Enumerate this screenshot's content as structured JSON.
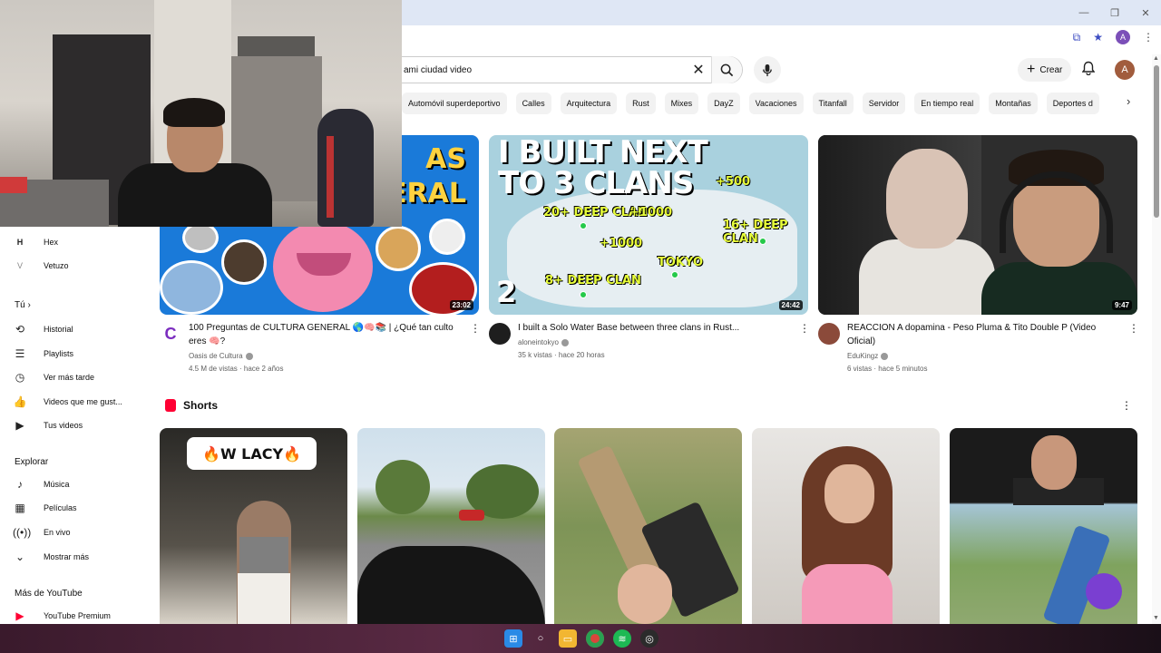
{
  "search": {
    "query": "ami ciudad video"
  },
  "header": {
    "create_label": "Crear",
    "avatar_letter": "A"
  },
  "browser": {
    "profile_letter": "A"
  },
  "chips": [
    "Automóvil superdeportivo",
    "Calles",
    "Arquitectura",
    "Rust",
    "Mixes",
    "DayZ",
    "Vacaciones",
    "Titanfall",
    "Servidor",
    "En tiempo real",
    "Montañas",
    "Deportes d"
  ],
  "sidebar": {
    "subs": [
      {
        "icon": "H",
        "label": "Hex"
      },
      {
        "icon": "V",
        "label": "Vetuzo"
      }
    ],
    "you_heading": "Tú",
    "you_items": [
      {
        "icon": "history-icon",
        "label": "Historial"
      },
      {
        "icon": "playlists-icon",
        "label": "Playlists"
      },
      {
        "icon": "watch-later-icon",
        "label": "Ver más tarde"
      },
      {
        "icon": "liked-icon",
        "label": "Videos que me gust..."
      },
      {
        "icon": "your-videos-icon",
        "label": "Tus videos"
      }
    ],
    "explore_heading": "Explorar",
    "explore_items": [
      {
        "icon": "music-icon",
        "label": "Música"
      },
      {
        "icon": "movies-icon",
        "label": "Películas"
      },
      {
        "icon": "live-icon",
        "label": "En vivo"
      },
      {
        "icon": "chevron-down-icon",
        "label": "Mostrar más"
      }
    ],
    "more_heading": "Más de YouTube",
    "more_items": [
      {
        "icon": "youtube-premium-icon",
        "label": "YouTube Premium"
      }
    ]
  },
  "videos": [
    {
      "thumb_text": "AS\nERAL",
      "duration": "23:02",
      "title": "100 Preguntas de CULTURA GENERAL 🌎🧠📚 | ¿Qué tan culto eres 🧠?",
      "channel": "Oasis de Cultura",
      "meta": "4.5 M de vistas · hace 2 años",
      "avatar_color": "#7b2cbf"
    },
    {
      "thumb_title": "I BUILT NEXT\nTO 3 CLANS",
      "thumb_labels": [
        "20+ DEEP CLAN",
        "+1000",
        "+500",
        "16+ DEEP CLAN",
        "+1000",
        "TOKYO",
        "8+ DEEP CLAN"
      ],
      "thumb_number": "2",
      "duration": "24:42",
      "title": "I built a Solo Water Base between three clans in Rust...",
      "channel": "aloneintokyo",
      "meta": "35 k vistas · hace 20 horas",
      "avatar_color": "#1e1e1e"
    },
    {
      "duration": "9:47",
      "title": "REACCION A dopamina - Peso Pluma & Tito Double P (Video Oficial)",
      "channel": "EduKingz",
      "meta": "6 vistas · hace 5 minutos",
      "avatar_color": "#8b4a3a"
    }
  ],
  "shorts": {
    "heading": "Shorts",
    "items": [
      {
        "overlay_text": "🔥W LACY🔥"
      },
      {
        "overlay_text": ""
      },
      {
        "overlay_text": ""
      },
      {
        "overlay_text": ""
      },
      {
        "overlay_text": ""
      }
    ]
  },
  "colors": {
    "accent": "#ff0033",
    "chip_bg": "#f2f2f2",
    "meta_text": "#606060"
  }
}
